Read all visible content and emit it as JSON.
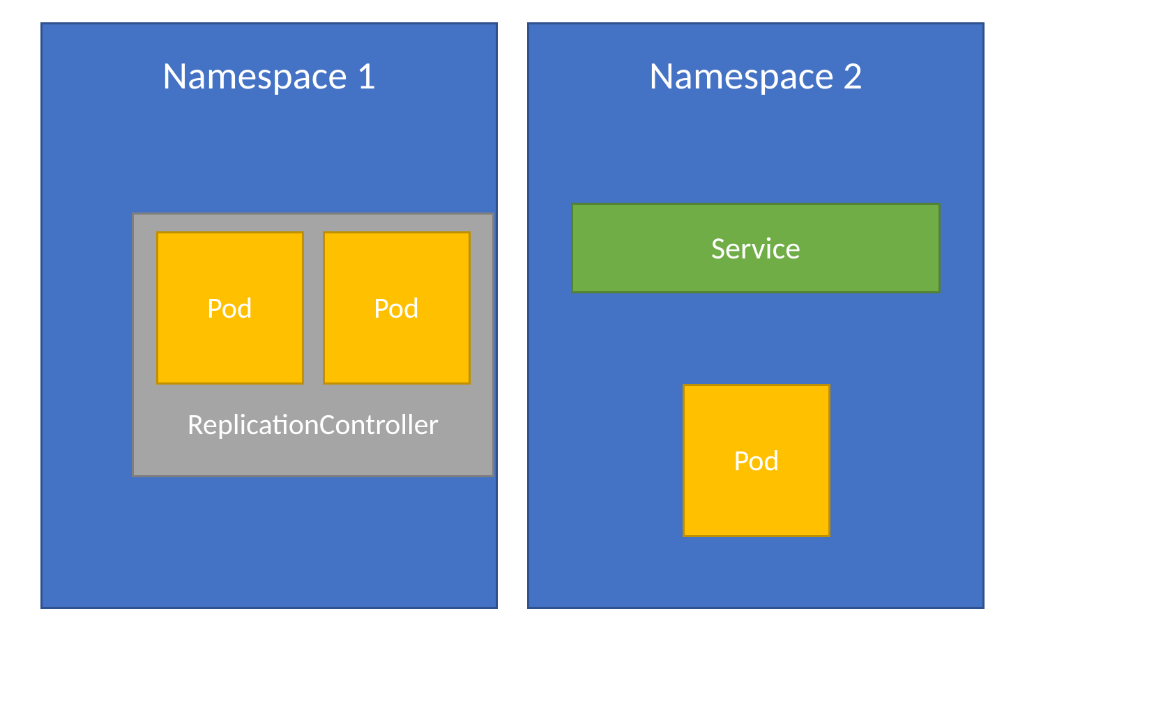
{
  "namespace1": {
    "title": "Namespace 1",
    "replicationController": {
      "label": "ReplicationController",
      "pods": [
        {
          "label": "Pod"
        },
        {
          "label": "Pod"
        }
      ]
    }
  },
  "namespace2": {
    "title": "Namespace 2",
    "service": {
      "label": "Service"
    },
    "pod": {
      "label": "Pod"
    }
  },
  "colors": {
    "namespace_fill": "#4472C4",
    "namespace_border": "#2F528F",
    "rc_fill": "#A5A5A5",
    "rc_border": "#7F7F7F",
    "pod_fill": "#FFC000",
    "pod_border": "#BF9000",
    "service_fill": "#70AD47",
    "service_border": "#548235",
    "text": "#FFFFFF"
  }
}
